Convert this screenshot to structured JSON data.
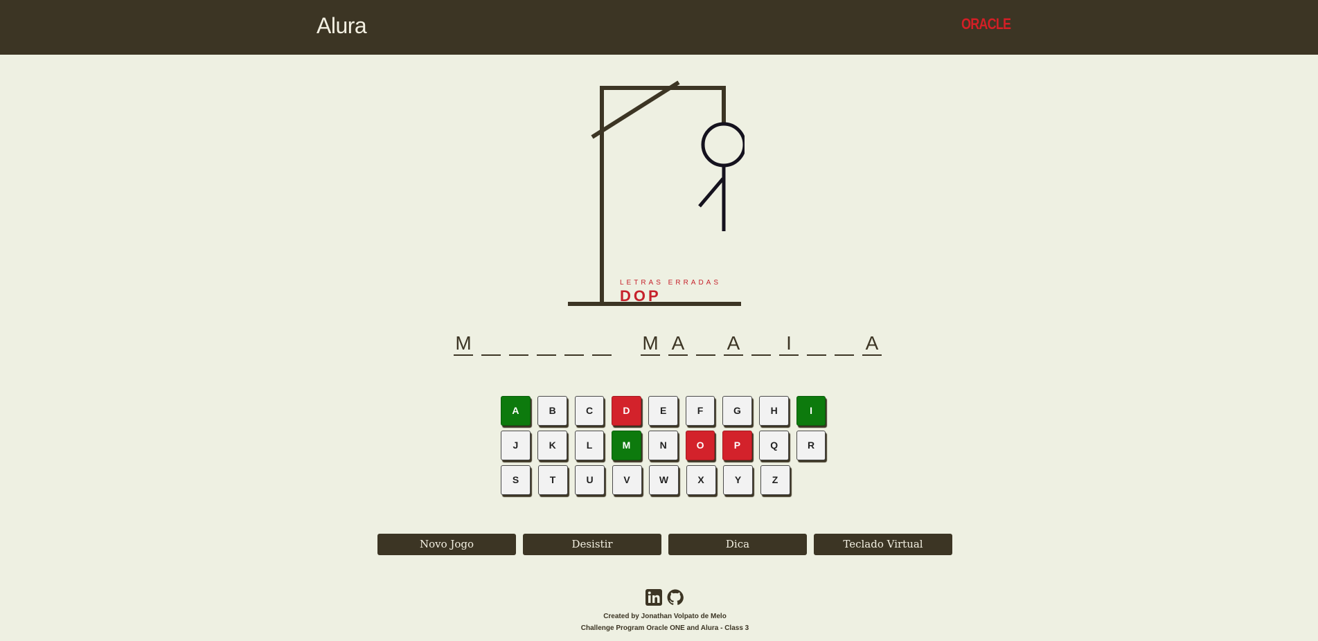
{
  "header": {
    "brand": "Alura",
    "partner_logo": "ORACLE",
    "partner_color": "#d31f26",
    "background": "#3c3524"
  },
  "game": {
    "wrong_title": "LETRAS ERRADAS",
    "wrong_letters": "DOP",
    "word_slots": [
      "M",
      "",
      "",
      "",
      "",
      "",
      " ",
      "M",
      "A",
      "",
      "A",
      "",
      "I",
      "",
      "",
      "A"
    ],
    "hangman_parts_shown": [
      "head",
      "body",
      "left-arm"
    ]
  },
  "keyboard": {
    "rows": [
      [
        {
          "letter": "A",
          "state": "hit"
        },
        {
          "letter": "B",
          "state": "unused"
        },
        {
          "letter": "C",
          "state": "unused"
        },
        {
          "letter": "D",
          "state": "miss"
        },
        {
          "letter": "E",
          "state": "unused"
        },
        {
          "letter": "F",
          "state": "unused"
        },
        {
          "letter": "G",
          "state": "unused"
        },
        {
          "letter": "H",
          "state": "unused"
        },
        {
          "letter": "I",
          "state": "hit"
        }
      ],
      [
        {
          "letter": "J",
          "state": "unused"
        },
        {
          "letter": "K",
          "state": "unused"
        },
        {
          "letter": "L",
          "state": "unused"
        },
        {
          "letter": "M",
          "state": "hit"
        },
        {
          "letter": "N",
          "state": "unused"
        },
        {
          "letter": "O",
          "state": "miss"
        },
        {
          "letter": "P",
          "state": "miss"
        },
        {
          "letter": "Q",
          "state": "unused"
        },
        {
          "letter": "R",
          "state": "unused"
        }
      ],
      [
        {
          "letter": "S",
          "state": "unused"
        },
        {
          "letter": "T",
          "state": "unused"
        },
        {
          "letter": "U",
          "state": "unused"
        },
        {
          "letter": "V",
          "state": "unused"
        },
        {
          "letter": "W",
          "state": "unused"
        },
        {
          "letter": "X",
          "state": "unused"
        },
        {
          "letter": "Y",
          "state": "unused"
        },
        {
          "letter": "Z",
          "state": "unused"
        }
      ]
    ],
    "hit_color": "#0d7a0d",
    "miss_color": "#d3222b"
  },
  "actions": {
    "new_game": "Novo Jogo",
    "give_up": "Desistir",
    "hint": "Dica",
    "virtual_keyboard": "Teclado Virtual"
  },
  "footer": {
    "social_icons": [
      "linkedin-icon",
      "github-icon"
    ],
    "credit_line1": "Created by Jonathan Volpato de Melo",
    "credit_line2": "Challenge Program Oracle ONE and Alura - Class 3"
  }
}
